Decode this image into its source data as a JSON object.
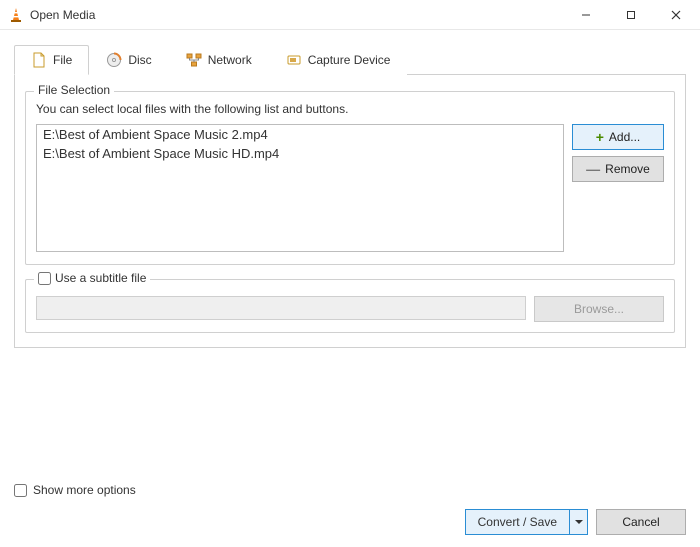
{
  "window": {
    "title": "Open Media"
  },
  "tabs": {
    "file": "File",
    "disc": "Disc",
    "network": "Network",
    "capture": "Capture Device"
  },
  "fileSelection": {
    "legend": "File Selection",
    "hint": "You can select local files with the following list and buttons.",
    "files": [
      "E:\\Best of Ambient Space Music 2.mp4",
      "E:\\Best of Ambient Space Music HD.mp4"
    ],
    "addLabel": "Add...",
    "removeLabel": "Remove"
  },
  "subtitle": {
    "checkboxLabel": "Use a subtitle file",
    "browseLabel": "Browse..."
  },
  "footer": {
    "moreOptions": "Show more options",
    "convertSave": "Convert / Save",
    "cancel": "Cancel"
  }
}
